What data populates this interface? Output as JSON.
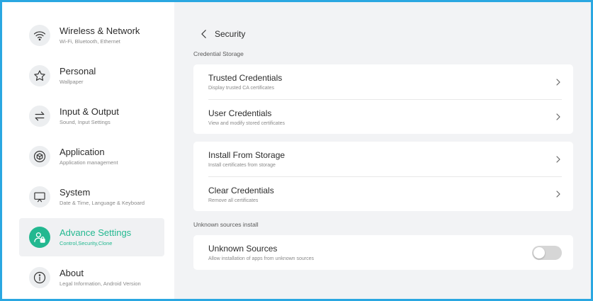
{
  "sidebar": {
    "items": [
      {
        "title": "Wireless & Network",
        "subtitle": "Wi-Fi, Bluetooth, Ethernet",
        "icon": "wifi-icon"
      },
      {
        "title": "Personal",
        "subtitle": "Wallpaper",
        "icon": "star-icon"
      },
      {
        "title": "Input & Output",
        "subtitle": "Sound, Input Settings",
        "icon": "swap-arrows-icon"
      },
      {
        "title": "Application",
        "subtitle": "Application management",
        "icon": "cube-icon"
      },
      {
        "title": "System",
        "subtitle": "Date & Time, Language & Keyboard",
        "icon": "monitor-icon"
      },
      {
        "title": "Advance Settings",
        "subtitle": "Control,Security,Clone",
        "icon": "user-lock-icon",
        "active": true
      },
      {
        "title": "About",
        "subtitle": "Legal Information, Android Version",
        "icon": "info-icon"
      }
    ]
  },
  "header": {
    "title": "Security",
    "back_icon": "chevron-left-icon"
  },
  "sections": {
    "credential_storage": {
      "label": "Credential Storage",
      "card1": [
        {
          "title": "Trusted Credentials",
          "subtitle": "Display trusted CA certificates"
        },
        {
          "title": "User Credentials",
          "subtitle": "View and modify stored certificates"
        }
      ],
      "card2": [
        {
          "title": "Install From Storage",
          "subtitle": "Install certificates from storage"
        },
        {
          "title": "Clear Credentials",
          "subtitle": "Remove all certificates"
        }
      ]
    },
    "unknown_sources": {
      "label": "Unknown sources install",
      "row": {
        "title": "Unknown Sources",
        "subtitle": "Allow installation of apps from unknown sources",
        "toggle_on": false
      }
    }
  },
  "colors": {
    "accent": "#23b890",
    "frame": "#2aa7e1",
    "background": "#f2f3f5"
  }
}
